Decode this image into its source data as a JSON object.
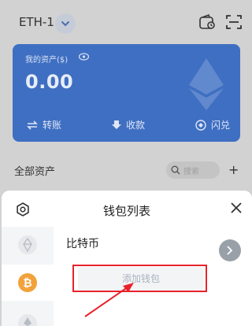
{
  "topbar": {
    "network_label": "ETH-1",
    "icons": [
      "chevron-down-icon",
      "wallet-icon",
      "scan-icon"
    ]
  },
  "card": {
    "asset_label": "我的资产($)",
    "balance": "0.00",
    "actions": {
      "transfer": "转账",
      "receive": "收款",
      "swap": "闪兑"
    }
  },
  "assets": {
    "title": "全部资产",
    "search_placeholder": "搜索"
  },
  "sheet": {
    "title": "钱包列表",
    "chains": [
      "EOS",
      "BTC",
      "ETH"
    ],
    "wallet_name": "比特币",
    "add_wallet_label": "添加钱包"
  },
  "colors": {
    "card": "#3f6fc2",
    "btc": "#f2a23a",
    "annotation": "#e8222a"
  }
}
